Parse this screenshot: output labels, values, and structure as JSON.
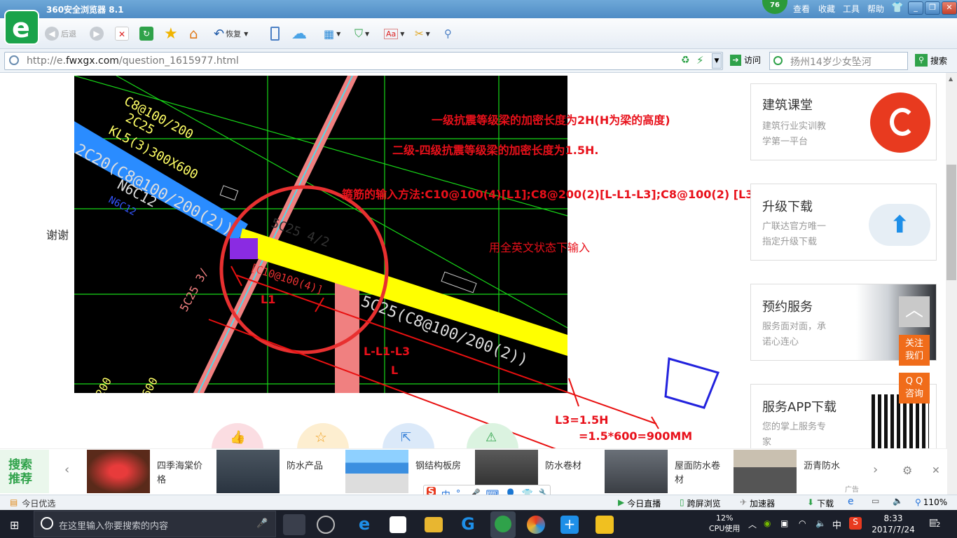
{
  "browser": {
    "title": "360安全浏览器 8.1",
    "badge": "76",
    "menu": [
      "查看",
      "收藏",
      "工具",
      "帮助"
    ],
    "back": "后退",
    "restore": "恢复",
    "url_prefix": "http://e.",
    "url_domain": "fwxgx.com",
    "url_path": "/question_1615977.html",
    "visit": "访问",
    "search_placeholder": "扬州14岁少女坠河",
    "search_btn": "搜索"
  },
  "page": {
    "thanks": "谢谢",
    "annotations": {
      "line1": "一级抗震等级梁的加密长度为2H(H为梁的高度)",
      "line2": "二级-四级抗震等级梁的加密长度为1.5H.",
      "line3": "箍筋的输入方法:C10@100(4)[L1];C8@200(2)[L-L1-L3];C8@100(2) [L3]",
      "line4": "900mm",
      "line5": "用全英文状态下输入",
      "l1": "L1",
      "lmid": "L-L1-L3",
      "l": "L",
      "l3a": "L3=1.5H",
      "l3b": "=1.5*600=900MM"
    },
    "cad": {
      "t1": "C8@100/200",
      "t2": "2C25",
      "t3": "KL5(3)300X600",
      "t4": "2C20(C8@100/200(2))",
      "t5": "N6C12",
      "t6": "N6C12",
      "t7": "5C25 4/2",
      "t8": "[C10@100(4)]",
      "t9": "5C25(C8@100/200(2))",
      "t10": "5C25 3/",
      "t11": "200",
      "t12": "600"
    }
  },
  "sidebar": {
    "cards": [
      {
        "title": "建筑课堂",
        "sub": [
          "建筑行业实训教",
          "学第一平台"
        ]
      },
      {
        "title": "升级下载",
        "sub": [
          "广联达官方唯一",
          "指定升级下载"
        ]
      },
      {
        "title": "预约服务",
        "sub": [
          "服务面对面，承",
          "诺心连心"
        ]
      },
      {
        "title": "服务APP下载",
        "sub": [
          "您的掌上服务专",
          "家"
        ]
      }
    ],
    "follow": [
      "关注",
      "我们"
    ],
    "qq": [
      "Q Q",
      "咨询"
    ]
  },
  "recommend": {
    "label": [
      "搜索",
      "推荐"
    ],
    "items": [
      "四季海棠价格",
      "防水产品",
      "钢结构板房",
      "防水卷材",
      "屋面防水卷材",
      "沥青防水"
    ],
    "ad": "广告"
  },
  "ime": {
    "text": "中"
  },
  "status": {
    "left": "今日优选",
    "live": "今日直播",
    "cross": "跨屏浏览",
    "speed": "加速器",
    "download": "下载",
    "zoom": "110%"
  },
  "taskbar": {
    "search": "在这里输入你要搜索的内容",
    "cpu_pct": "12%",
    "cpu_label": "CPU使用",
    "ime": "中",
    "time": "8:33",
    "date": "2017/7/24",
    "notif": "2"
  }
}
